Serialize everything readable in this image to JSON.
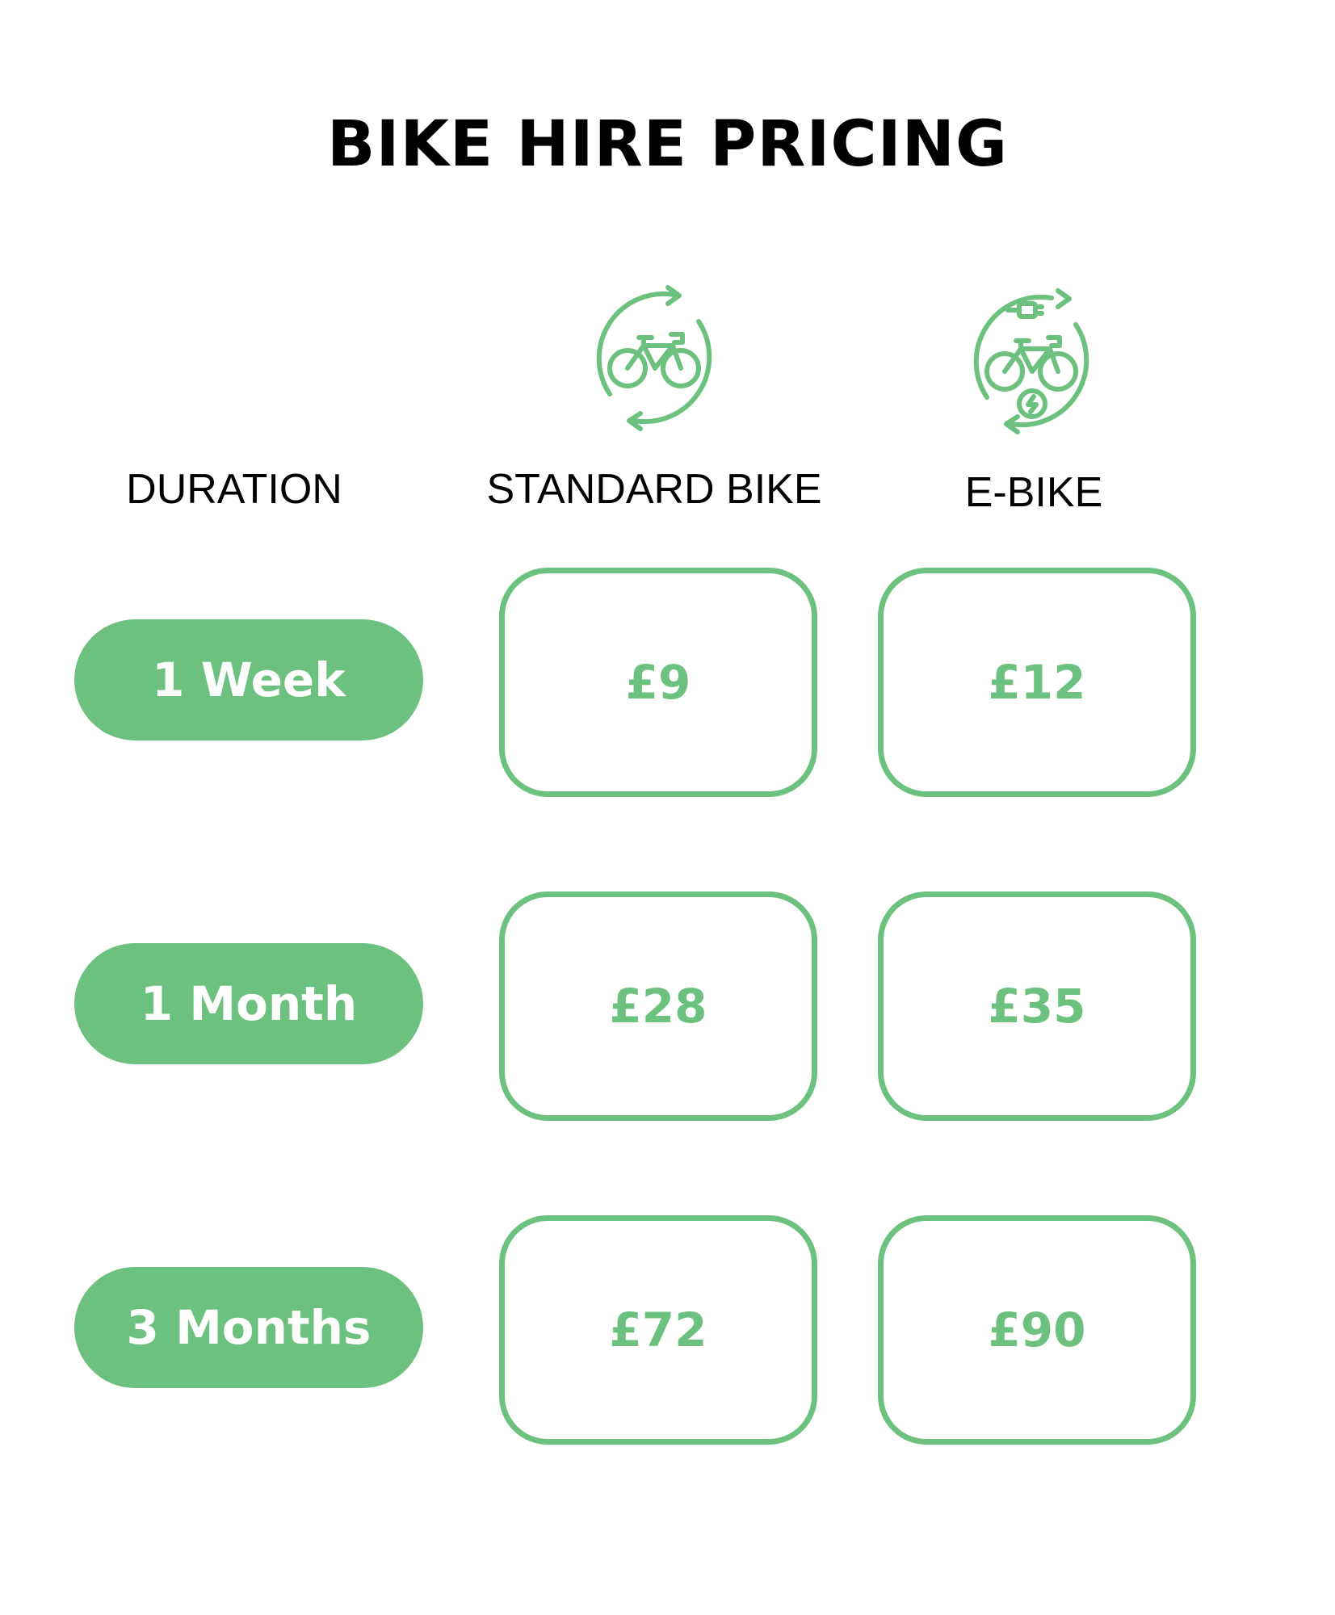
{
  "title": "BIKE HIRE PRICING",
  "headers": {
    "duration": "DURATION",
    "standard": "STANDARD BIKE",
    "ebike": "E-BIKE"
  },
  "icons": {
    "standard": "bike-cycle-icon",
    "ebike": "ebike-cycle-icon"
  },
  "colors": {
    "accent": "#6bc17d",
    "text": "#000000",
    "background": "#ffffff"
  },
  "rows": [
    {
      "duration": "1 Week",
      "standard": "£9",
      "ebike": "£12"
    },
    {
      "duration": "1 Month",
      "standard": "£28",
      "ebike": "£35"
    },
    {
      "duration": "3 Months",
      "standard": "£72",
      "ebike": "£90"
    }
  ]
}
